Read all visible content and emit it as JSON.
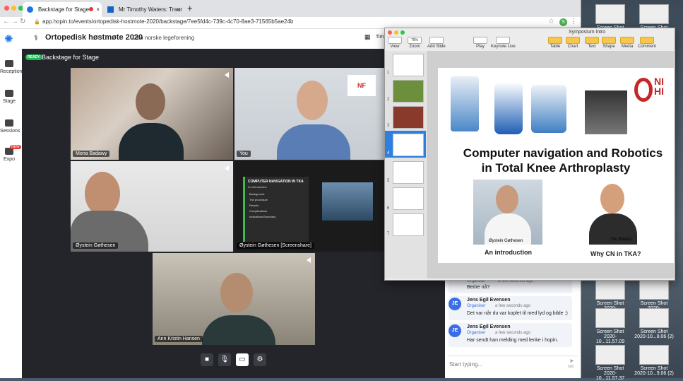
{
  "browser": {
    "tabs": [
      {
        "title": "Backstage for Stage",
        "active": true
      },
      {
        "title": "Mr Timothy Waters: Trauma & ",
        "active": false
      }
    ],
    "new_tab": "+",
    "url": "app.hopin.to/events/ortopedisk-hostmote-2020/backstage/7ee5fd4c-739c-4c70-8ae3-71565b5ae24b",
    "profile_letter": "S"
  },
  "hopin": {
    "event_title": "Ortopedisk høstmøte 2020",
    "organizer": "Den norske legeforening",
    "timetable_truncated": "Tim"
  },
  "nav": {
    "items": [
      {
        "label": "Reception"
      },
      {
        "label": "Stage"
      },
      {
        "label": "Sessions"
      },
      {
        "label": "Expo",
        "badge": "NEW"
      }
    ]
  },
  "stage": {
    "ready_badge": "READY",
    "title": "Backstage for Stage",
    "participants": [
      {
        "name": "Mona Badawy"
      },
      {
        "name": "You"
      },
      {
        "name": "Øystein Gøthesen"
      },
      {
        "name": "Øystein Gøthesen [Screenshare]"
      },
      {
        "name": "Ann Kristin Hansen"
      }
    ],
    "screenshare": {
      "title": "COMPUTER NAVIGATION IN TKA",
      "subtitle": "An introduction",
      "bullets": [
        "Background",
        "The procedure",
        "Results",
        "Complications",
        "Indications/Summary"
      ]
    }
  },
  "keynote": {
    "window_title": "Symposium intro",
    "zoom": "75%",
    "toolbar": [
      "View",
      "Zoom",
      "Add Slide",
      "Play",
      "Keynote Live",
      "Table",
      "Chart",
      "Text",
      "Shape",
      "Media",
      "Comment"
    ],
    "slide_numbers": [
      "1",
      "2",
      "3",
      "4",
      "5",
      "6",
      "7"
    ],
    "selected_slide": 4,
    "slide": {
      "title_line1": "Computer navigation and Robotics",
      "title_line2": "in Total Knee Arthroplasty",
      "left_caption_name": "Øystein Gøthesen",
      "left_caption": "An introduction",
      "right_caption_name": "Tim  Waters",
      "right_caption": "Why CN in TKA?"
    }
  },
  "chat": {
    "messages": [
      {
        "author": "Organiser",
        "time": "a few seconds ago",
        "text": "Bedre nå?",
        "partial": true
      },
      {
        "author": "Jens Egil Evensen",
        "role": "Organiser",
        "time": "a few seconds ago",
        "text": "Det var når du var koplet til med lyd og bilde :)",
        "initials": "JE"
      },
      {
        "author": "Jens Egil Evensen",
        "role": "Organiser",
        "time": "a few seconds ago",
        "text": "Har sendt han melding med lenke i hopin.",
        "initials": "JE"
      }
    ],
    "input_placeholder": "Start typing...",
    "char_limit": "500"
  },
  "desktop": {
    "files": [
      {
        "label": "Screen Shot"
      },
      {
        "label": "Screen Shot"
      },
      {
        "label": "Screen Shot 2020-10...11.56.56"
      },
      {
        "label": "Screen Shot 2020-10...20.54.16"
      },
      {
        "label": "Screen Shot 2020-10...11.57.09"
      },
      {
        "label": "Screen Shot 2020-10...8.06 (2)"
      },
      {
        "label": "Screen Shot 2020-10...11.57.37"
      },
      {
        "label": "Screen Shot 2020-10...9.06 (2)"
      }
    ],
    "bottom_labels": [
      "2020-10...11.45.05",
      "2020-10...11.57.37",
      "2020-10...9.06 (2)"
    ]
  }
}
